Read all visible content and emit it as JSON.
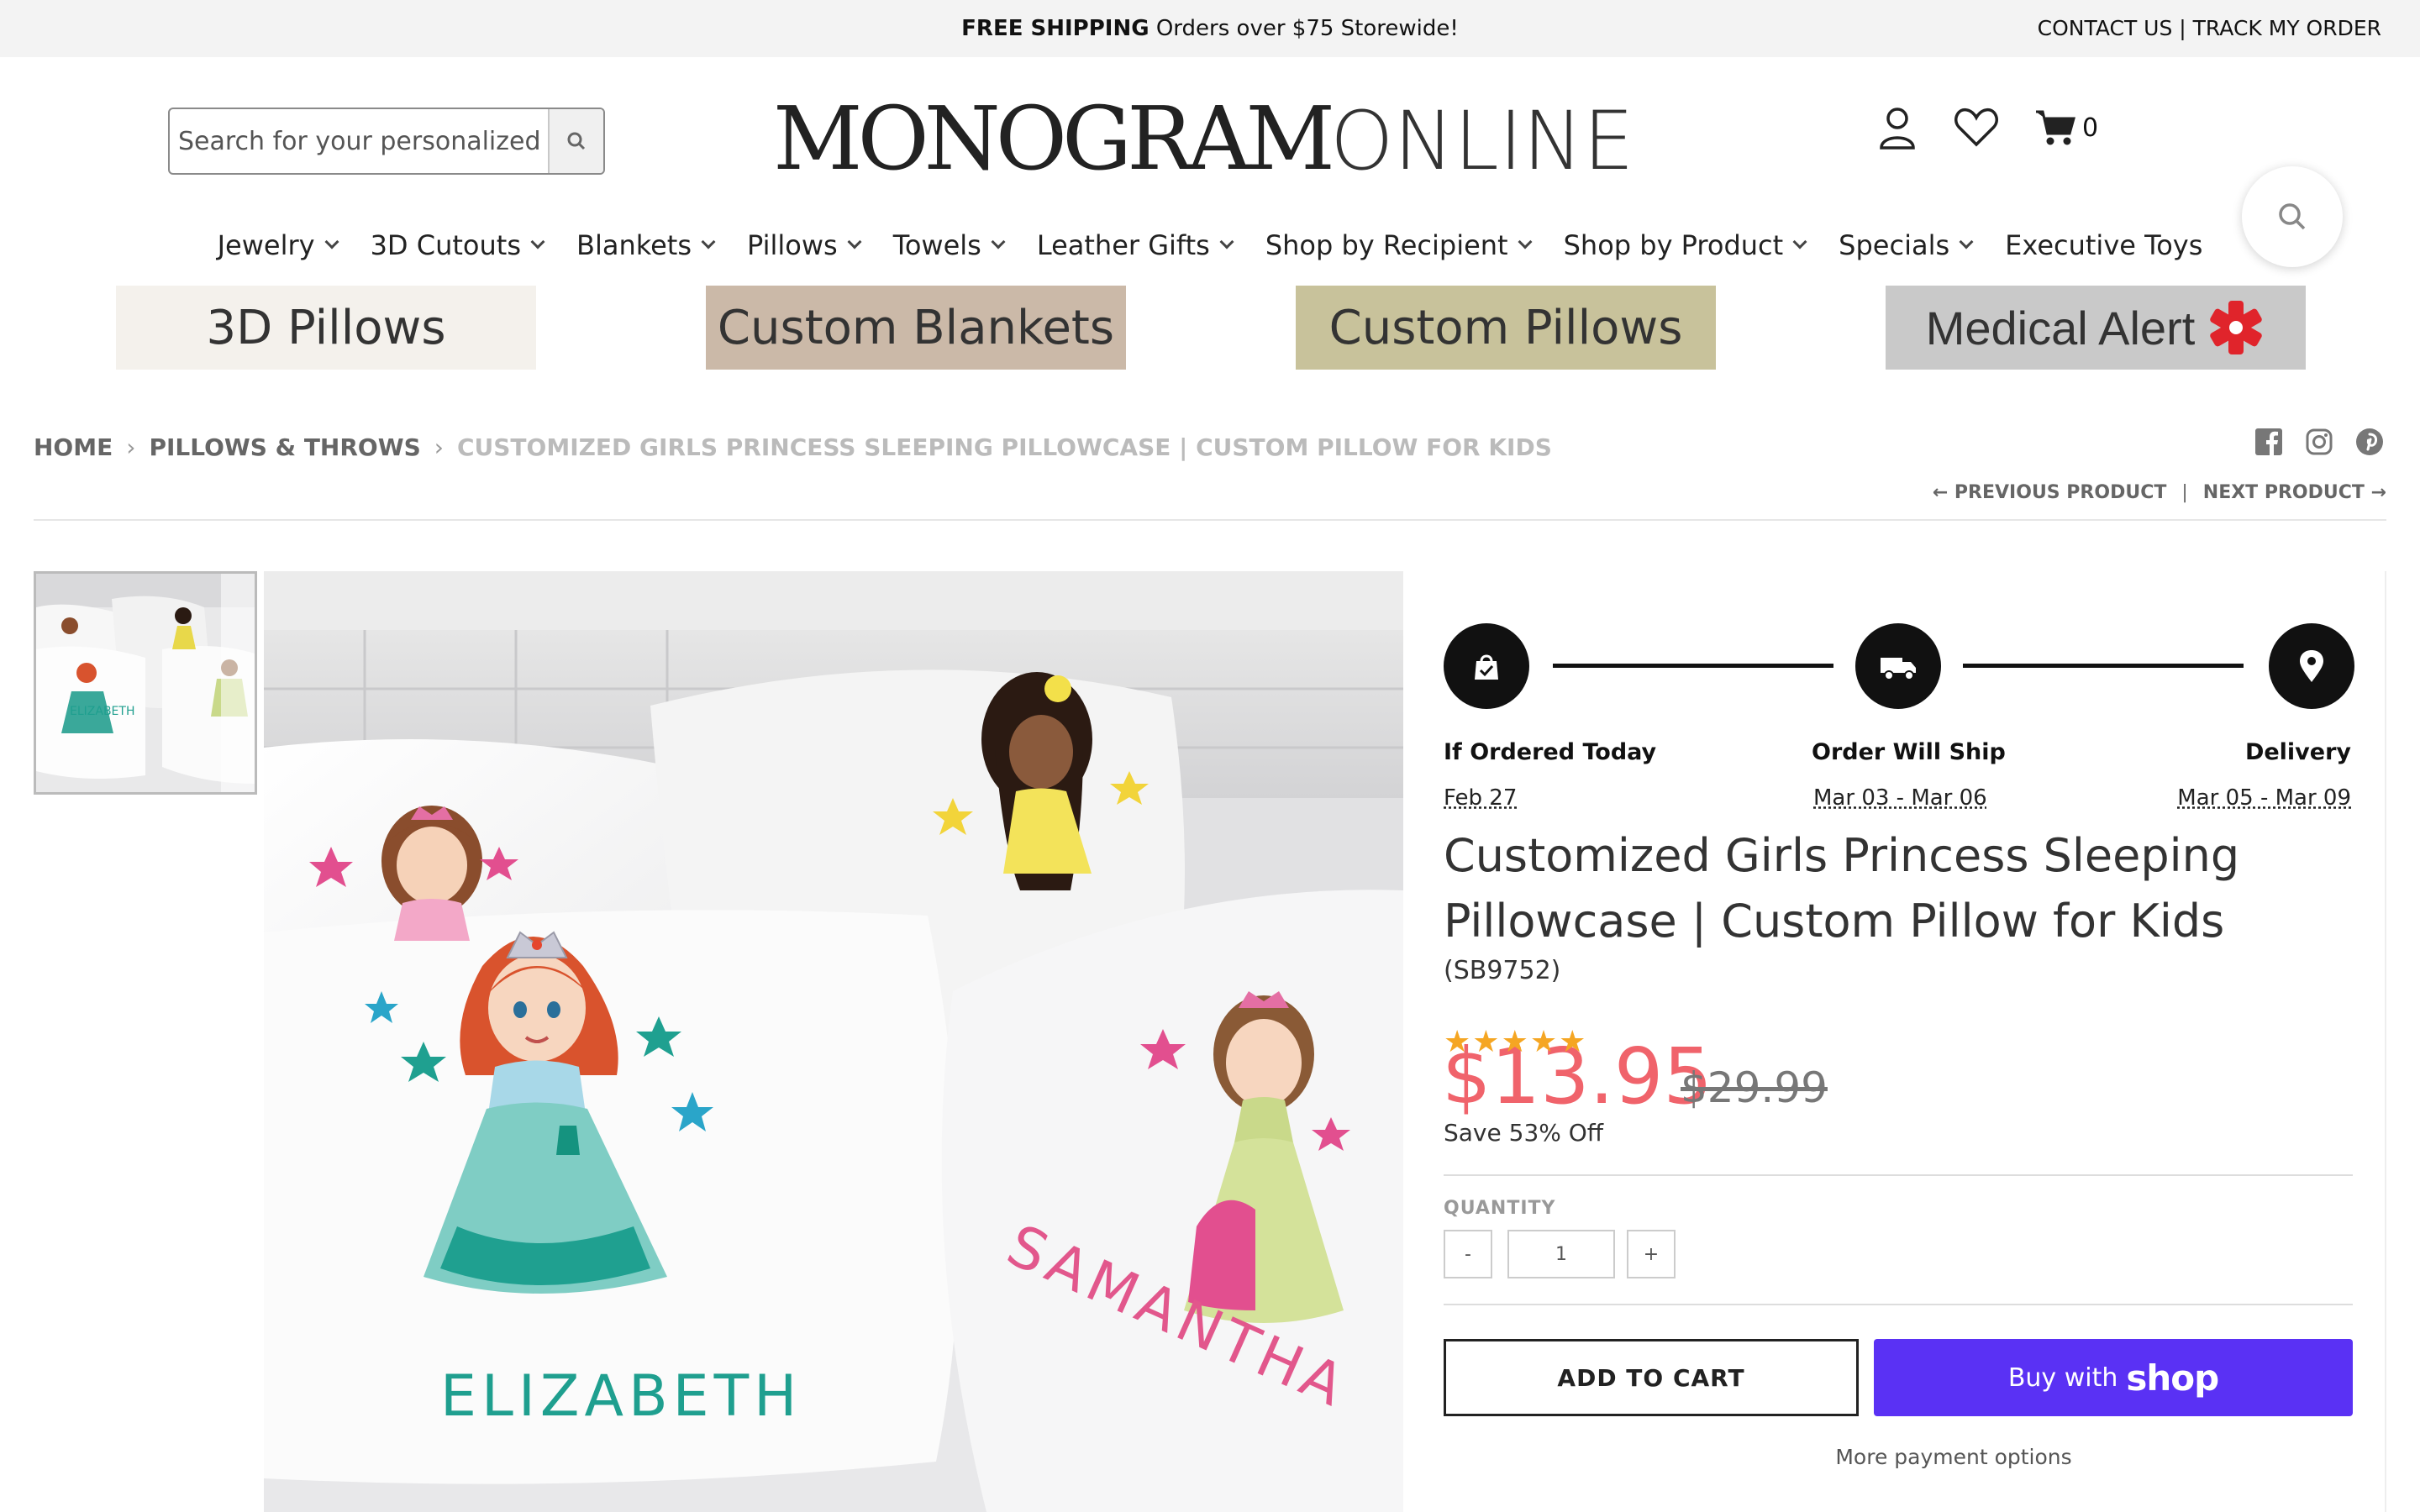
{
  "topbar": {
    "promo_bold": "FREE SHIPPING",
    "promo_rest": " Orders over $75 Storewide!",
    "links": "CONTACT US | TRACK MY ORDER"
  },
  "header": {
    "search_placeholder": "Search for your personalized gift",
    "logo_part1": "MONOGRAM",
    "logo_part2": "ONLINE",
    "cart_count": "0"
  },
  "nav": {
    "items": [
      {
        "label": "Jewelry",
        "dropdown": true
      },
      {
        "label": "3D Cutouts",
        "dropdown": true
      },
      {
        "label": "Blankets",
        "dropdown": true
      },
      {
        "label": "Pillows",
        "dropdown": true
      },
      {
        "label": "Towels",
        "dropdown": true
      },
      {
        "label": "Leather Gifts",
        "dropdown": true
      },
      {
        "label": "Shop by Recipient",
        "dropdown": true
      },
      {
        "label": "Shop by Product",
        "dropdown": true
      },
      {
        "label": "Specials",
        "dropdown": true
      },
      {
        "label": "Executive Toys",
        "dropdown": false
      }
    ]
  },
  "banners": [
    {
      "label": "3D Pillows",
      "bg": "#f4f1ec"
    },
    {
      "label": "Custom Blankets",
      "bg": "#cbb9a8"
    },
    {
      "label": "Custom Pillows",
      "bg": "#c8c29b"
    },
    {
      "label": "Medical Alert",
      "bg": "#c9c9c9"
    }
  ],
  "breadcrumb": {
    "home": "HOME",
    "category": "PILLOWS & THROWS",
    "current": "CUSTOMIZED GIRLS PRINCESS SLEEPING PILLOWCASE | CUSTOM PILLOW FOR KIDS"
  },
  "prevnext": {
    "prev": "← PREVIOUS PRODUCT",
    "divider": "|",
    "next": "NEXT PRODUCT →"
  },
  "image": {
    "name_left": "ELIZABETH",
    "name_right": "SAMANTHA"
  },
  "delivery": {
    "steps": [
      {
        "label": "If Ordered Today",
        "date": "Feb 27"
      },
      {
        "label": "Order Will Ship",
        "date": "Mar 03 - Mar 06"
      },
      {
        "label": "Delivery",
        "date": "Mar 05 - Mar 09"
      }
    ]
  },
  "product": {
    "title": "Customized Girls Princess Sleeping Pillowcase | Custom Pillow for Kids",
    "sku": "(SB9752)",
    "rating": 5,
    "price": "$13.95",
    "old_price": "$29.99",
    "save_text": "Save 53% Off",
    "quantity_label": "QUANTITY",
    "quantity": "1",
    "minus": "-",
    "plus": "+",
    "add_to_cart": "ADD TO CART",
    "buy_with": "Buy with",
    "shop_word": "shop",
    "more_payment": "More payment options"
  },
  "colors": {
    "price": "#f0636b",
    "shop_pay": "#5a31f4",
    "star": "#f5a623"
  }
}
